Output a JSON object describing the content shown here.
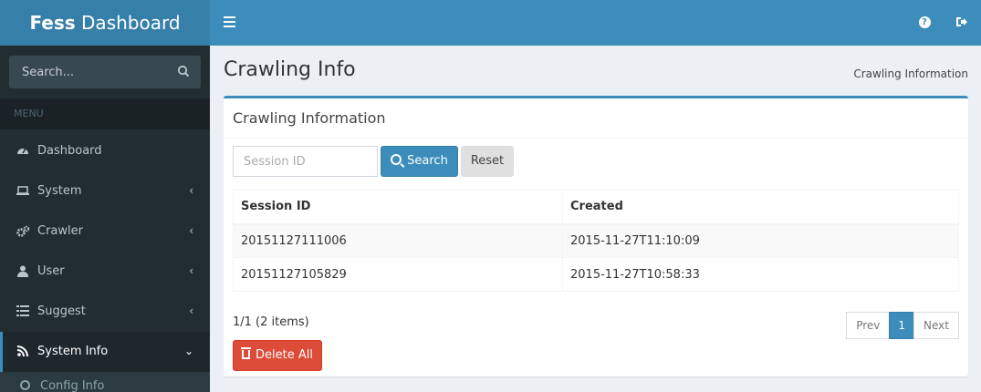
{
  "header": {
    "logo_bold": "Fess",
    "logo_rest": "Dashboard"
  },
  "sidebar": {
    "search_placeholder": "Search...",
    "menu_header": "MENU",
    "items": [
      {
        "label": "Dashboard",
        "icon": "dashboard-icon"
      },
      {
        "label": "System",
        "icon": "laptop-icon"
      },
      {
        "label": "Crawler",
        "icon": "cogs-icon"
      },
      {
        "label": "User",
        "icon": "user-icon"
      },
      {
        "label": "Suggest",
        "icon": "list-icon"
      },
      {
        "label": "System Info",
        "icon": "rss-icon"
      }
    ],
    "sub_items": [
      {
        "label": "Config Info"
      }
    ]
  },
  "page": {
    "title": "Crawling Info",
    "breadcrumb": "Crawling Information"
  },
  "box": {
    "title": "Crawling Information",
    "session_placeholder": "Session ID",
    "search_label": "Search",
    "reset_label": "Reset",
    "columns": [
      "Session ID",
      "Created"
    ],
    "rows": [
      [
        "20151127111006",
        "2015-11-27T11:10:09"
      ],
      [
        "20151127105829",
        "2015-11-27T10:58:33"
      ]
    ],
    "count_text": "1/1 (2 items)",
    "pager": {
      "prev": "Prev",
      "current": "1",
      "next": "Next"
    },
    "delete_label": "Delete All"
  },
  "colors": {
    "primary": "#3c8dbc",
    "sidebar": "#222d32",
    "danger": "#dd4b39"
  }
}
